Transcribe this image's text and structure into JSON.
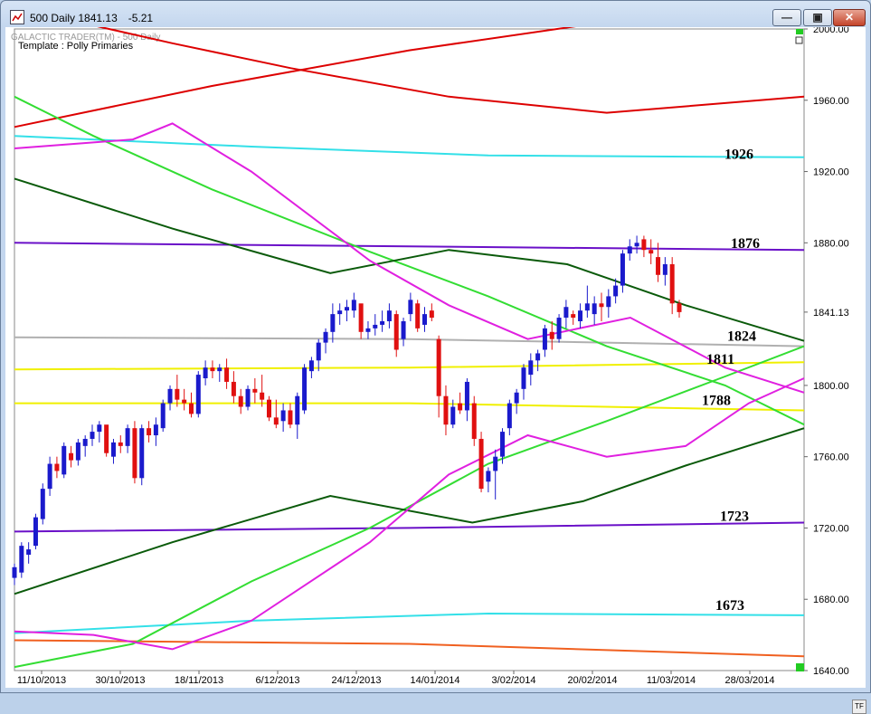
{
  "window": {
    "title": "500 Daily 1841.13",
    "change": "-5.21",
    "min_label": "—",
    "max_label": "▣",
    "close_label": "✕"
  },
  "header": {
    "line1": "GALACTIC TRADER(TM) - 500 Daily",
    "line2": "Template : Polly Primaries"
  },
  "tf_label": "TF",
  "colors": {
    "up": "#1a1acc",
    "down": "#e01010",
    "red": "#dd0000",
    "cyan": "#33e0e8",
    "green": "#33dd33",
    "darkgreen": "#0a5a0a",
    "magenta": "#e020e0",
    "purple": "#6a10c8",
    "yellow": "#f0f000",
    "gray": "#b0b0b0",
    "orange": "#f06020"
  },
  "chart_data": {
    "type": "candlestick",
    "ylim": [
      1640,
      2000
    ],
    "y_ticks": [
      "2000.00",
      "1960.00",
      "1920.00",
      "1880.00",
      "1841.13",
      "1800.00",
      "1760.00",
      "1720.00",
      "1680.00",
      "1640.00"
    ],
    "y_tick_values": [
      2000,
      1960,
      1920,
      1880,
      1841.13,
      1800,
      1760,
      1720,
      1680,
      1640
    ],
    "x_ticks": [
      "11/10/2013",
      "30/10/2013",
      "18/11/2013",
      "6/12/2013",
      "24/12/2013",
      "14/01/2014",
      "3/02/2014",
      "20/02/2014",
      "11/03/2014",
      "28/03/2014"
    ],
    "last_price": "1841.13",
    "annotations": [
      "1926",
      "1876",
      "1824",
      "1811",
      "1788",
      "1723",
      "1673"
    ],
    "annotation_values": [
      1926,
      1876,
      1824,
      1811,
      1788,
      1723,
      1673
    ],
    "candles_ohlc": [
      [
        1692,
        1700,
        1688,
        1698
      ],
      [
        1695,
        1712,
        1692,
        1710
      ],
      [
        1705,
        1712,
        1700,
        1708
      ],
      [
        1710,
        1728,
        1708,
        1726
      ],
      [
        1725,
        1745,
        1722,
        1742
      ],
      [
        1742,
        1760,
        1738,
        1756
      ],
      [
        1756,
        1760,
        1748,
        1752
      ],
      [
        1750,
        1768,
        1748,
        1766
      ],
      [
        1762,
        1766,
        1754,
        1758
      ],
      [
        1758,
        1770,
        1755,
        1768
      ],
      [
        1766,
        1772,
        1760,
        1770
      ],
      [
        1770,
        1778,
        1766,
        1774
      ],
      [
        1774,
        1780,
        1768,
        1778
      ],
      [
        1778,
        1776,
        1760,
        1762
      ],
      [
        1760,
        1770,
        1756,
        1768
      ],
      [
        1768,
        1772,
        1762,
        1766
      ],
      [
        1766,
        1778,
        1762,
        1776
      ],
      [
        1776,
        1780,
        1745,
        1748
      ],
      [
        1748,
        1778,
        1744,
        1776
      ],
      [
        1776,
        1780,
        1768,
        1772
      ],
      [
        1772,
        1782,
        1766,
        1778
      ],
      [
        1776,
        1792,
        1774,
        1790
      ],
      [
        1790,
        1800,
        1786,
        1798
      ],
      [
        1798,
        1806,
        1788,
        1792
      ],
      [
        1792,
        1798,
        1786,
        1790
      ],
      [
        1790,
        1796,
        1782,
        1784
      ],
      [
        1784,
        1808,
        1782,
        1806
      ],
      [
        1804,
        1814,
        1800,
        1810
      ],
      [
        1810,
        1814,
        1804,
        1808
      ],
      [
        1808,
        1812,
        1802,
        1810
      ],
      [
        1810,
        1815,
        1798,
        1802
      ],
      [
        1802,
        1808,
        1790,
        1794
      ],
      [
        1794,
        1798,
        1784,
        1788
      ],
      [
        1788,
        1800,
        1786,
        1798
      ],
      [
        1798,
        1804,
        1790,
        1796
      ],
      [
        1796,
        1806,
        1788,
        1792
      ],
      [
        1792,
        1794,
        1780,
        1782
      ],
      [
        1782,
        1792,
        1776,
        1778
      ],
      [
        1780,
        1790,
        1774,
        1786
      ],
      [
        1786,
        1790,
        1776,
        1778
      ],
      [
        1778,
        1796,
        1770,
        1794
      ],
      [
        1786,
        1812,
        1784,
        1810
      ],
      [
        1808,
        1816,
        1804,
        1814
      ],
      [
        1814,
        1826,
        1808,
        1824
      ],
      [
        1824,
        1832,
        1818,
        1830
      ],
      [
        1830,
        1846,
        1824,
        1840
      ],
      [
        1840,
        1846,
        1834,
        1842
      ],
      [
        1842,
        1848,
        1836,
        1844
      ],
      [
        1842,
        1852,
        1838,
        1848
      ],
      [
        1846,
        1840,
        1826,
        1830
      ],
      [
        1830,
        1836,
        1826,
        1832
      ],
      [
        1832,
        1840,
        1828,
        1834
      ],
      [
        1834,
        1842,
        1830,
        1836
      ],
      [
        1836,
        1846,
        1832,
        1842
      ],
      [
        1840,
        1842,
        1816,
        1820
      ],
      [
        1826,
        1838,
        1822,
        1836
      ],
      [
        1840,
        1852,
        1836,
        1848
      ],
      [
        1846,
        1848,
        1830,
        1832
      ],
      [
        1834,
        1844,
        1830,
        1840
      ],
      [
        1842,
        1846,
        1836,
        1838
      ],
      [
        1826,
        1828,
        1782,
        1794
      ],
      [
        1794,
        1800,
        1772,
        1778
      ],
      [
        1778,
        1792,
        1776,
        1788
      ],
      [
        1790,
        1796,
        1784,
        1786
      ],
      [
        1786,
        1804,
        1780,
        1802
      ],
      [
        1790,
        1794,
        1766,
        1770
      ],
      [
        1770,
        1774,
        1740,
        1742
      ],
      [
        1746,
        1754,
        1740,
        1752
      ],
      [
        1752,
        1764,
        1736,
        1760
      ],
      [
        1760,
        1776,
        1756,
        1774
      ],
      [
        1776,
        1792,
        1772,
        1790
      ],
      [
        1790,
        1798,
        1784,
        1796
      ],
      [
        1798,
        1812,
        1792,
        1810
      ],
      [
        1806,
        1818,
        1800,
        1814
      ],
      [
        1814,
        1820,
        1808,
        1818
      ],
      [
        1820,
        1834,
        1816,
        1832
      ],
      [
        1830,
        1836,
        1820,
        1826
      ],
      [
        1826,
        1840,
        1824,
        1838
      ],
      [
        1838,
        1848,
        1832,
        1844
      ],
      [
        1840,
        1842,
        1834,
        1838
      ],
      [
        1836,
        1846,
        1832,
        1842
      ],
      [
        1842,
        1856,
        1838,
        1846
      ],
      [
        1840,
        1850,
        1834,
        1846
      ],
      [
        1846,
        1852,
        1836,
        1844
      ],
      [
        1844,
        1854,
        1838,
        1850
      ],
      [
        1850,
        1860,
        1846,
        1856
      ],
      [
        1856,
        1876,
        1852,
        1874
      ],
      [
        1874,
        1882,
        1870,
        1878
      ],
      [
        1878,
        1884,
        1874,
        1880
      ],
      [
        1882,
        1884,
        1872,
        1876
      ],
      [
        1876,
        1882,
        1868,
        1874
      ],
      [
        1872,
        1880,
        1858,
        1862
      ],
      [
        1862,
        1872,
        1856,
        1868
      ],
      [
        1868,
        1872,
        1840,
        1846
      ],
      [
        1846,
        1848,
        1838,
        1841.13
      ]
    ],
    "lines": [
      {
        "color": "red",
        "points": [
          [
            0,
            1945
          ],
          [
            0.25,
            1968
          ],
          [
            0.5,
            1988
          ],
          [
            0.75,
            2004
          ],
          [
            1,
            2015
          ]
        ]
      },
      {
        "color": "red",
        "points": [
          [
            0,
            2012
          ],
          [
            0.2,
            1992
          ],
          [
            0.35,
            1978
          ],
          [
            0.55,
            1962
          ],
          [
            0.75,
            1953
          ],
          [
            1,
            1962
          ]
        ]
      },
      {
        "color": "cyan",
        "points": [
          [
            0,
            1940
          ],
          [
            0.3,
            1934
          ],
          [
            0.6,
            1929
          ],
          [
            1,
            1928
          ]
        ]
      },
      {
        "color": "cyan",
        "points": [
          [
            0,
            1661
          ],
          [
            0.3,
            1668
          ],
          [
            0.6,
            1672
          ],
          [
            1,
            1671
          ]
        ]
      },
      {
        "color": "purple",
        "points": [
          [
            0,
            1880
          ],
          [
            0.5,
            1878
          ],
          [
            1,
            1876
          ]
        ]
      },
      {
        "color": "purple",
        "points": [
          [
            0,
            1718
          ],
          [
            0.5,
            1720
          ],
          [
            1,
            1723
          ]
        ]
      },
      {
        "color": "gray",
        "points": [
          [
            0,
            1827
          ],
          [
            0.5,
            1826
          ],
          [
            1,
            1822
          ]
        ]
      },
      {
        "color": "yellow",
        "points": [
          [
            0,
            1809
          ],
          [
            0.5,
            1810
          ],
          [
            1,
            1813
          ]
        ]
      },
      {
        "color": "yellow",
        "points": [
          [
            0,
            1790
          ],
          [
            0.5,
            1790
          ],
          [
            1,
            1786
          ]
        ]
      },
      {
        "color": "orange",
        "points": [
          [
            0,
            1657
          ],
          [
            0.5,
            1655
          ],
          [
            1,
            1648
          ]
        ]
      },
      {
        "color": "green",
        "points": [
          [
            0,
            1962
          ],
          [
            0.1,
            1940
          ],
          [
            0.25,
            1910
          ],
          [
            0.45,
            1875
          ],
          [
            0.6,
            1850
          ],
          [
            0.75,
            1822
          ],
          [
            0.9,
            1800
          ],
          [
            1,
            1778
          ]
        ]
      },
      {
        "color": "green",
        "points": [
          [
            0,
            1642
          ],
          [
            0.15,
            1655
          ],
          [
            0.3,
            1690
          ],
          [
            0.45,
            1720
          ],
          [
            0.6,
            1756
          ],
          [
            0.75,
            1780
          ],
          [
            0.9,
            1805
          ],
          [
            1,
            1822
          ]
        ]
      },
      {
        "color": "darkgreen",
        "points": [
          [
            0,
            1916
          ],
          [
            0.2,
            1888
          ],
          [
            0.4,
            1863
          ],
          [
            0.55,
            1876
          ],
          [
            0.7,
            1868
          ],
          [
            0.85,
            1845
          ],
          [
            1,
            1825
          ]
        ]
      },
      {
        "color": "darkgreen",
        "points": [
          [
            0,
            1683
          ],
          [
            0.2,
            1712
          ],
          [
            0.4,
            1738
          ],
          [
            0.58,
            1723
          ],
          [
            0.72,
            1735
          ],
          [
            0.85,
            1755
          ],
          [
            1,
            1776
          ]
        ]
      },
      {
        "color": "magenta",
        "points": [
          [
            0,
            1933
          ],
          [
            0.15,
            1938
          ],
          [
            0.2,
            1947
          ],
          [
            0.3,
            1920
          ],
          [
            0.45,
            1870
          ],
          [
            0.55,
            1845
          ],
          [
            0.65,
            1826
          ],
          [
            0.78,
            1838
          ],
          [
            0.9,
            1810
          ],
          [
            1,
            1796
          ]
        ]
      },
      {
        "color": "magenta",
        "points": [
          [
            0,
            1662
          ],
          [
            0.1,
            1660
          ],
          [
            0.2,
            1652
          ],
          [
            0.3,
            1668
          ],
          [
            0.45,
            1712
          ],
          [
            0.55,
            1750
          ],
          [
            0.65,
            1772
          ],
          [
            0.75,
            1760
          ],
          [
            0.85,
            1766
          ],
          [
            0.93,
            1790
          ],
          [
            1,
            1804
          ]
        ]
      }
    ]
  }
}
